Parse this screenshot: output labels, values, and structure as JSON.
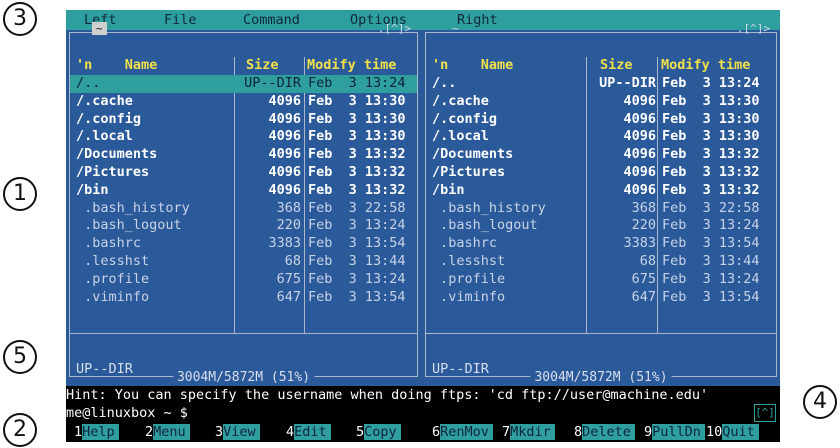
{
  "callouts": [
    "3",
    "1",
    "5",
    "2",
    "4"
  ],
  "menubar": [
    "Left",
    "File",
    "Command",
    "Options",
    "Right"
  ],
  "left_panel": {
    "path": "~",
    "history_marker": ".[^]>",
    "columns": {
      "name": "'n    Name",
      "size": "Size",
      "modify": "Modify time"
    },
    "rows": [
      {
        "name": "/..",
        "size": "UP--DIR",
        "date": "Feb  3 13:24",
        "type": "sel"
      },
      {
        "name": "/.cache",
        "size": "4096",
        "date": "Feb  3 13:30",
        "type": "dir"
      },
      {
        "name": "/.config",
        "size": "4096",
        "date": "Feb  3 13:30",
        "type": "dir"
      },
      {
        "name": "/.local",
        "size": "4096",
        "date": "Feb  3 13:30",
        "type": "dir"
      },
      {
        "name": "/Documents",
        "size": "4096",
        "date": "Feb  3 13:32",
        "type": "dir"
      },
      {
        "name": "/Pictures",
        "size": "4096",
        "date": "Feb  3 13:32",
        "type": "dir"
      },
      {
        "name": "/bin",
        "size": "4096",
        "date": "Feb  3 13:32",
        "type": "dir"
      },
      {
        "name": " .bash_history",
        "size": "368",
        "date": "Feb  3 22:58",
        "type": "file"
      },
      {
        "name": " .bash_logout",
        "size": "220",
        "date": "Feb  3 13:24",
        "type": "file"
      },
      {
        "name": " .bashrc",
        "size": "3383",
        "date": "Feb  3 13:54",
        "type": "file"
      },
      {
        "name": " .lesshst",
        "size": "68",
        "date": "Feb  3 13:44",
        "type": "file"
      },
      {
        "name": " .profile",
        "size": "675",
        "date": "Feb  3 13:24",
        "type": "file"
      },
      {
        "name": " .viminfo",
        "size": "647",
        "date": "Feb  3 13:54",
        "type": "file"
      }
    ],
    "status": "UP--DIR",
    "disk": "3004M/5872M (51%)"
  },
  "right_panel": {
    "path": "~",
    "history_marker": ".[^]>",
    "columns": {
      "name": "'n    Name",
      "size": "Size",
      "modify": "Modify time"
    },
    "rows": [
      {
        "name": "/..",
        "size": "UP--DIR",
        "date": "Feb  3 13:24",
        "type": "dir"
      },
      {
        "name": "/.cache",
        "size": "4096",
        "date": "Feb  3 13:30",
        "type": "dir"
      },
      {
        "name": "/.config",
        "size": "4096",
        "date": "Feb  3 13:30",
        "type": "dir"
      },
      {
        "name": "/.local",
        "size": "4096",
        "date": "Feb  3 13:30",
        "type": "dir"
      },
      {
        "name": "/Documents",
        "size": "4096",
        "date": "Feb  3 13:32",
        "type": "dir"
      },
      {
        "name": "/Pictures",
        "size": "4096",
        "date": "Feb  3 13:32",
        "type": "dir"
      },
      {
        "name": "/bin",
        "size": "4096",
        "date": "Feb  3 13:32",
        "type": "dir"
      },
      {
        "name": " .bash_history",
        "size": "368",
        "date": "Feb  3 22:58",
        "type": "file"
      },
      {
        "name": " .bash_logout",
        "size": "220",
        "date": "Feb  3 13:24",
        "type": "file"
      },
      {
        "name": " .bashrc",
        "size": "3383",
        "date": "Feb  3 13:54",
        "type": "file"
      },
      {
        "name": " .lesshst",
        "size": "68",
        "date": "Feb  3 13:44",
        "type": "file"
      },
      {
        "name": " .profile",
        "size": "675",
        "date": "Feb  3 13:24",
        "type": "file"
      },
      {
        "name": " .viminfo",
        "size": "647",
        "date": "Feb  3 13:54",
        "type": "file"
      }
    ],
    "status": "UP--DIR",
    "disk": "3004M/5872M (51%)"
  },
  "hint": "Hint: You can specify the username when doing ftps: 'cd ftp://user@machine.edu'",
  "prompt": "me@linuxbox ~ $",
  "prompt_arrow": "[^]",
  "fkeys": [
    {
      "num": "1",
      "label": "Help"
    },
    {
      "num": "2",
      "label": "Menu"
    },
    {
      "num": "3",
      "label": "View"
    },
    {
      "num": "4",
      "label": "Edit"
    },
    {
      "num": "5",
      "label": "Copy"
    },
    {
      "num": "6",
      "label": "RenMov"
    },
    {
      "num": "7",
      "label": "Mkdir"
    },
    {
      "num": "8",
      "label": "Delete"
    },
    {
      "num": "9",
      "label": "PullDn"
    },
    {
      "num": "10",
      "label": "Quit"
    }
  ],
  "colors": {
    "panel_bg": "#2b5a9a",
    "menubar_bg": "#2f9e9e",
    "header_text": "#f2e04a",
    "dir_text": "#ffffff",
    "file_text": "#c7d3e6"
  }
}
